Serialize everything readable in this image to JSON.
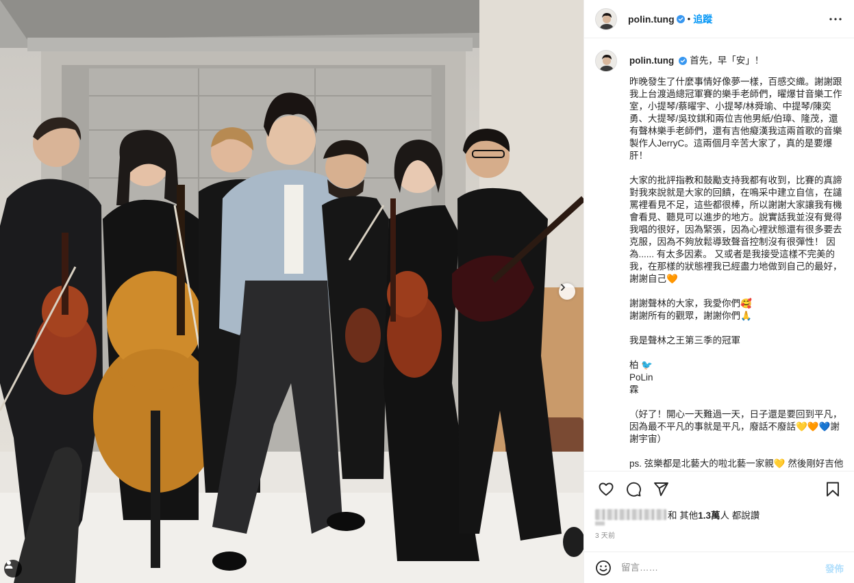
{
  "post": {
    "username": "polin.tung",
    "verified": true,
    "follow_label": "追蹤",
    "header_dot": "•",
    "photo_alt": "Group photo of musicians with violins, cello and guitar"
  },
  "caption": {
    "opening": "首先，早「安」！",
    "paragraphs": [
      [
        "昨晚發生了什麼事情好像夢一樣，百感交織。謝謝跟",
        "我上台渡過總冠軍賽的樂手老師們，曜爆甘音樂工作",
        "室，小提琴/蔡曜宇、小提琴/林舜瑜、中提琴/陳奕",
        "勇、大提琴/吳玟錤和兩位吉他男紙/伯璋、隆茂，還",
        "有聲林樂手老師們，還有吉他癡漢我這兩首歌的音樂",
        "製作人JerryC。這兩個月辛苦大家了，真的是要爆",
        "肝！"
      ],
      [
        "大家的批評指教和鼓勵支持我都有收到，比賽的真諦",
        "對我來說就是大家的回饋，在鳴采中建立自信，在譴",
        "罵裡看見不足，這些都很棒，所以謝謝大家讓我有機",
        "會看見、聽見可以進步的地方。說實話我並沒有覺得",
        "我唱的很好，因為緊張，因為心裡狀態還有很多要去",
        "克服，因為不夠放鬆導致聲音控制沒有很彈性！ 因",
        "為...... 有太多因素。 又或者是我接受這樣不完美的",
        "我，在那樣的狀態裡我已經盡力地做到自己的最好，",
        "謝謝自己🧡"
      ],
      [
        "謝謝聲林的大家，我愛你們🥰",
        "謝謝所有的觀眾，謝謝你們🙏"
      ],
      [
        "我是聲林之王第三季的冠軍"
      ],
      [
        "柏 🐦",
        "PoLin",
        "霖"
      ],
      [
        "（好了！開心一天難過一天，日子還是要回到平凡，",
        "因為最不平凡的事就是平凡，廢話不廢話💛🧡💙謝",
        "謝宇宙）"
      ],
      [
        "ps. 弦樂都是北藝大的啦北藝一家親💛 然後剛好吉他"
      ]
    ]
  },
  "likes": {
    "prefix": "和 其他 ",
    "count": "1.3萬",
    "suffix": " 人 都說讚"
  },
  "timestamp": "3 天前",
  "comment": {
    "placeholder": "留言……",
    "post_label": "發佈"
  },
  "icons": {
    "verified": "verified-badge-icon",
    "more": "more-options-icon",
    "like": "heart-icon",
    "comment": "comment-bubble-icon",
    "share": "paper-plane-icon",
    "save": "bookmark-icon",
    "emoji": "smiley-icon",
    "carousel": "chevron-right-icon",
    "tag": "user-tag-icon"
  },
  "colors": {
    "link_blue": "#0095f6",
    "verified_blue": "#3897f0",
    "post_disabled": "#b2dffc",
    "muted": "#8e8e8e",
    "text": "#262626"
  }
}
